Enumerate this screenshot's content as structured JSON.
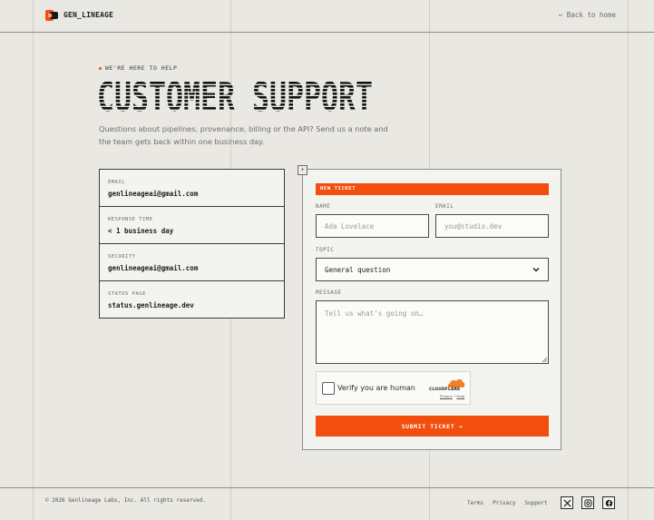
{
  "header": {
    "brand": "GEN_LINEAGE",
    "back_link": "← Back to home"
  },
  "hero": {
    "eyebrow": "WE'RE HERE TO HELP",
    "title": "CUSTOMER SUPPORT",
    "intro": "Questions about pipelines, provenance, billing or the API? Send us a note and the team gets back within one business day."
  },
  "contact_info": [
    {
      "label": "EMAIL",
      "value": "genlineageai@gmail.com"
    },
    {
      "label": "RESPONSE TIME",
      "value": "< 1 business day"
    },
    {
      "label": "SECURITY",
      "value": "genlineageai@gmail.com"
    },
    {
      "label": "STATUS PAGE",
      "value": "status.genlineage.dev"
    }
  ],
  "form": {
    "marker": "+",
    "badge": "NEW TICKET",
    "name_label": "NAME",
    "name_placeholder": "Ada Lovelace",
    "email_label": "EMAIL",
    "email_placeholder": "you@studio.dev",
    "topic_label": "TOPIC",
    "topic_selected": "General question",
    "message_label": "MESSAGE",
    "message_placeholder": "Tell us what's going on…",
    "captcha_label": "Verify you are human",
    "captcha_brand": "CLOUDFLARE",
    "captcha_privacy": "Privacy",
    "captcha_sep": " • ",
    "captcha_help": "Help",
    "submit_label": "SUBMIT TICKET →"
  },
  "footer": {
    "copyright": "© 2026 Genlineage Labs, Inc. All rights reserved.",
    "links": [
      "Terms",
      "Privacy",
      "Support"
    ],
    "social_icons": [
      "x-icon",
      "instagram-icon",
      "facebook-icon"
    ]
  },
  "colors": {
    "accent": "#f24e0d",
    "background": "#e9e8e3",
    "panel": "#f3f3ef"
  }
}
